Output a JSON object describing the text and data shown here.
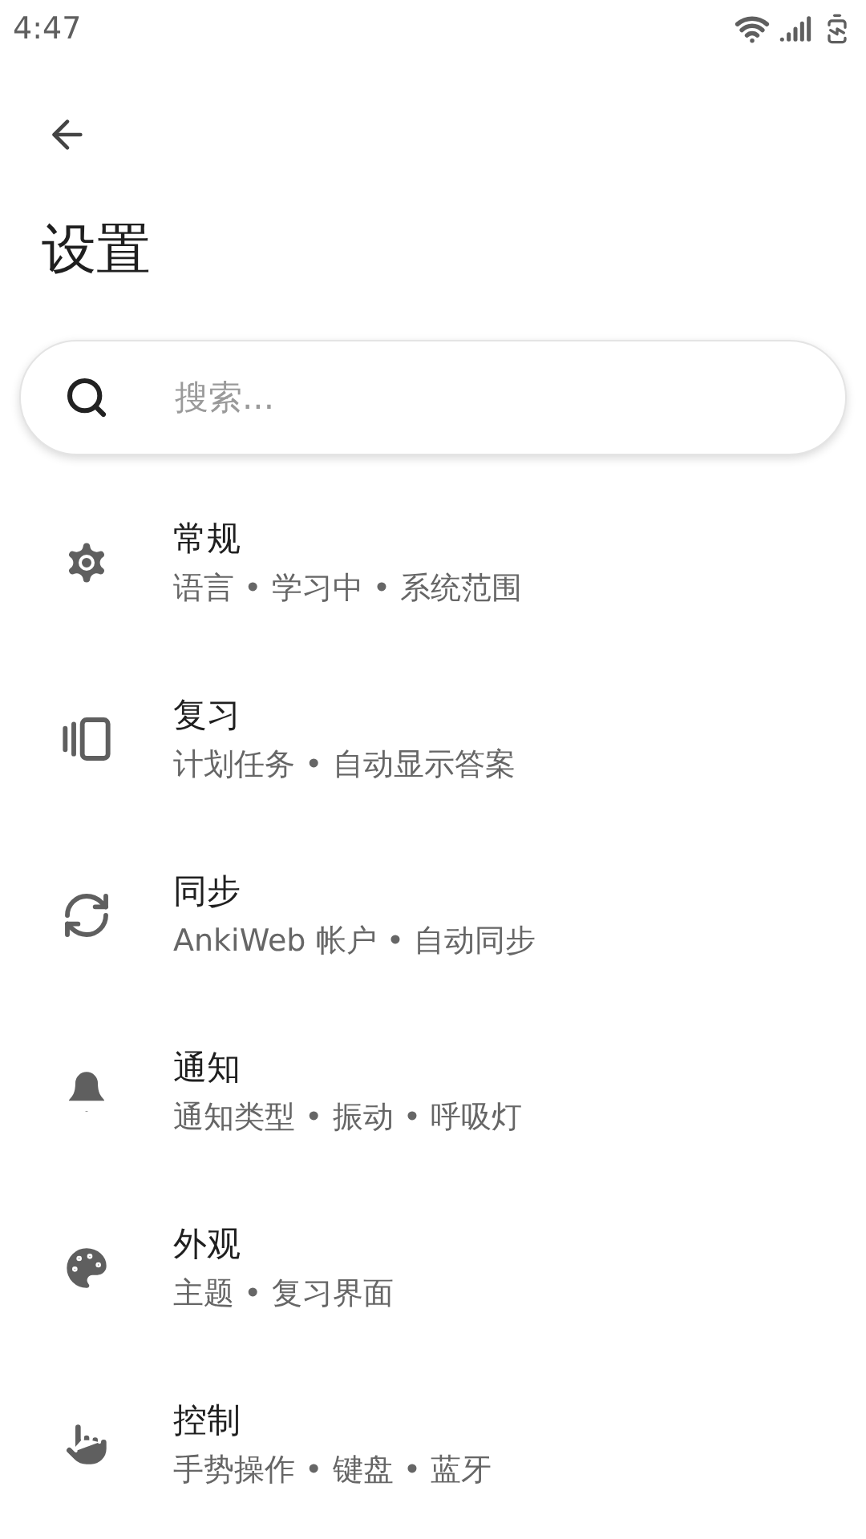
{
  "status_bar": {
    "time": "4:47"
  },
  "title": "设置",
  "search": {
    "placeholder": "搜索..."
  },
  "items": [
    {
      "kind": "general",
      "title": "常规",
      "subtitle": "语言 • 学习中 • 系统范围"
    },
    {
      "kind": "review",
      "title": "复习",
      "subtitle": "计划任务 • 自动显示答案"
    },
    {
      "kind": "sync",
      "title": "同步",
      "subtitle": "AnkiWeb 帐户 • 自动同步"
    },
    {
      "kind": "notifications",
      "title": "通知",
      "subtitle": "通知类型 • 振动 • 呼吸灯"
    },
    {
      "kind": "appearance",
      "title": "外观",
      "subtitle": "主题 • 复习界面"
    },
    {
      "kind": "controls",
      "title": "控制",
      "subtitle": "手势操作 • 键盘 • 蓝牙"
    }
  ]
}
